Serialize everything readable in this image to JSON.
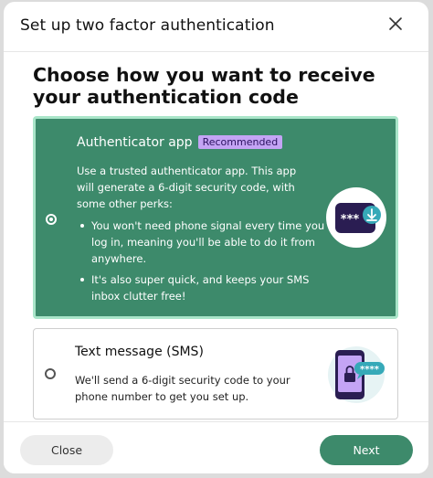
{
  "modal": {
    "title": "Set up two factor authentication",
    "heading": "Choose how you want to receive your authentication code"
  },
  "options": [
    {
      "title": "Authenticator app",
      "badge": "Recommended",
      "description": "Use a trusted authenticator app. This app will generate a 6-digit security code, with some other perks:",
      "perks": [
        "You won't need phone signal every time you log in, meaning you'll be able to do it from anywhere.",
        "It's also super quick, and keeps your SMS inbox clutter free!"
      ],
      "selected": true,
      "code_glyph": "***",
      "icon": "authenticator-app-icon"
    },
    {
      "title": "Text message (SMS)",
      "description": "We'll send a 6-digit security code to your phone number to get you set up.",
      "selected": false,
      "code_glyph": "****",
      "icon": "sms-phone-icon"
    }
  ],
  "footer": {
    "close_label": "Close",
    "next_label": "Next"
  },
  "colors": {
    "accent": "#3d8a6b",
    "accent_border": "#a9e5c9",
    "badge_bg": "#c4a4f5",
    "app_icon_bg": "#2a1d52",
    "teal": "#36a9b8"
  }
}
